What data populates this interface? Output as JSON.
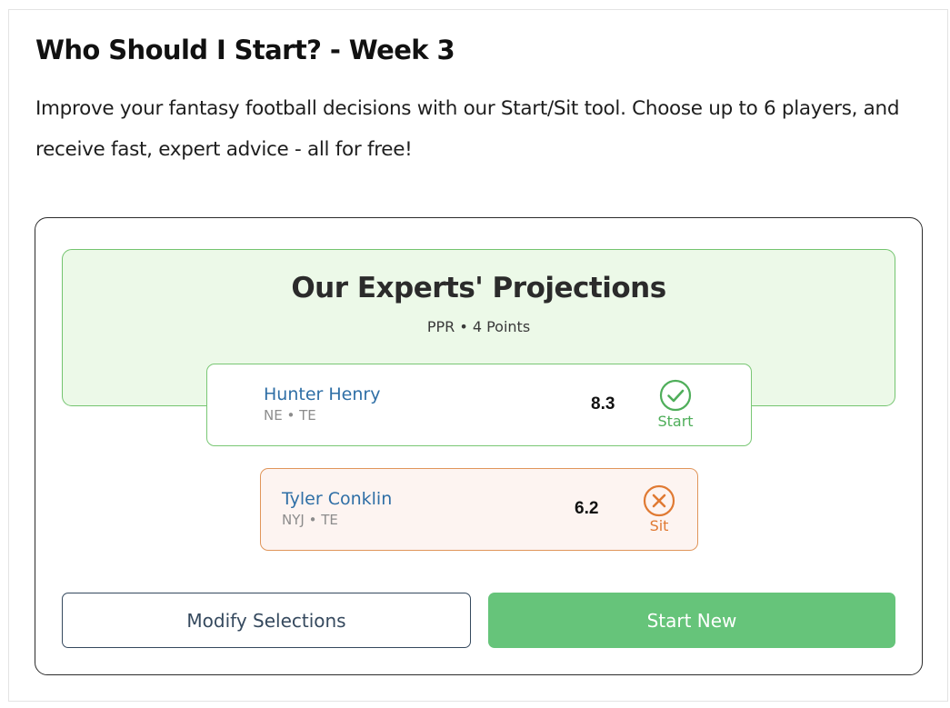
{
  "header": {
    "title": "Who Should I Start? - Week 3",
    "intro": "Improve your fantasy football decisions with our Start/Sit tool. Choose up to 6 players, and receive fast, expert advice - all for free!"
  },
  "projections": {
    "title": "Our Experts' Projections",
    "subtitle": "PPR • 4 Points",
    "players": [
      {
        "name": "Hunter Henry",
        "meta": "NE • TE",
        "points": "8.3",
        "verdict": "Start",
        "verdict_icon": "check-circle-icon",
        "color": "#4fae5a"
      },
      {
        "name": "Tyler Conklin",
        "meta": "NYJ • TE",
        "points": "6.2",
        "verdict": "Sit",
        "verdict_icon": "x-circle-icon",
        "color": "#e07a33"
      }
    ]
  },
  "actions": {
    "modify_label": "Modify Selections",
    "start_new_label": "Start New"
  },
  "colors": {
    "accent_green": "#66c47a",
    "banner_bg": "#ecf9e8",
    "link_blue": "#2f6fa6",
    "sit_orange": "#e07a33"
  }
}
